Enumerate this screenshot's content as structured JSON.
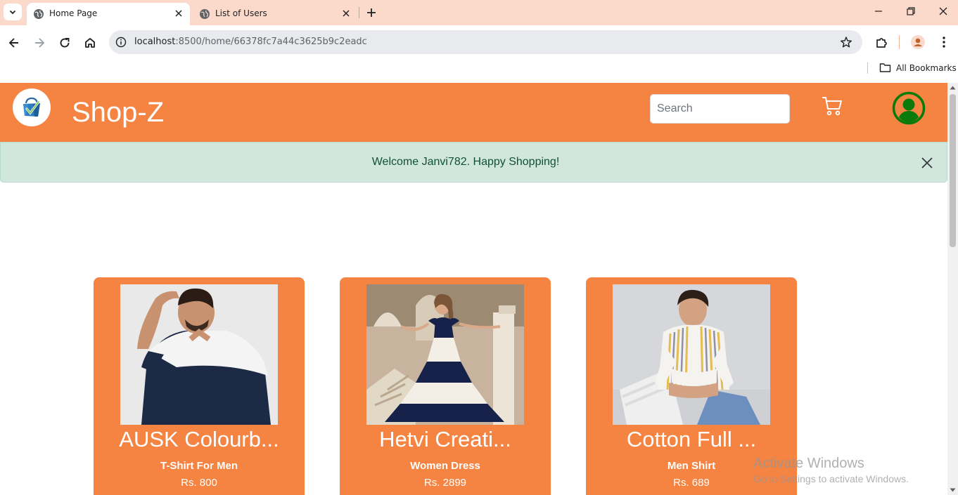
{
  "browser": {
    "tabs": [
      {
        "title": "Home Page",
        "active": true
      },
      {
        "title": "List of Users",
        "active": false
      }
    ],
    "url": {
      "host": "localhost",
      "rest": ":8500/home/66378fc7a44c3625b9c2eadc"
    },
    "bookmarks_label": "All Bookmarks"
  },
  "site": {
    "brand": "Shop-Z",
    "search_placeholder": "Search",
    "accent_color": "#f58442",
    "alert": {
      "message": "Welcome Janvi782. Happy Shopping!"
    }
  },
  "products": [
    {
      "title": "AUSK Colourb...",
      "category": "T-Shirt For Men",
      "price": "Rs. 800"
    },
    {
      "title": "Hetvi Creati...",
      "category": "Women Dress",
      "price": "Rs. 2899"
    },
    {
      "title": "Cotton Full ...",
      "category": "Men Shirt",
      "price": "Rs. 689"
    }
  ],
  "watermark": {
    "line1": "Activate Windows",
    "line2": "Go to Settings to activate Windows."
  }
}
